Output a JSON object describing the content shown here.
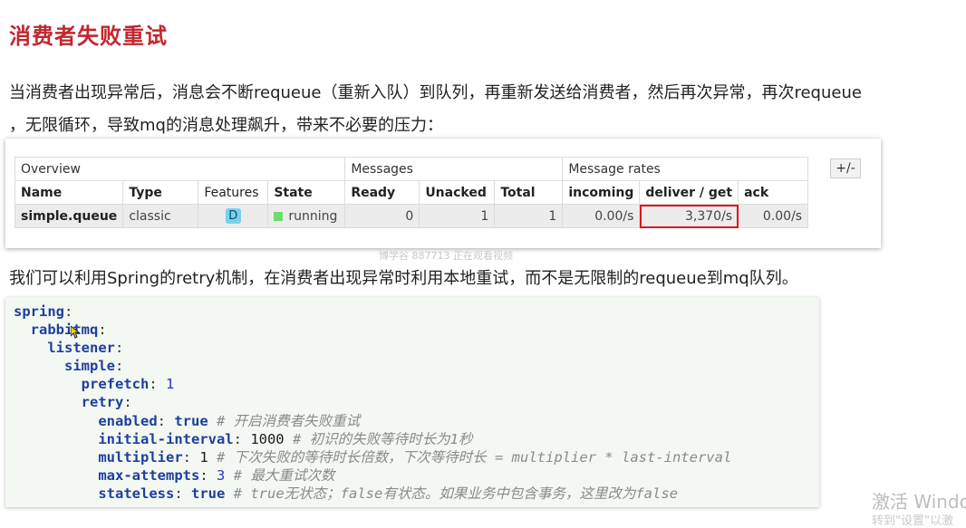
{
  "title": "消费者失败重试",
  "paragraph1": "当消费者出现异常后，消息会不断requeue（重新入队）到队列，再重新发送给消费者，然后再次异常，再次requeue",
  "paragraph2": "，无限循环，导致mq的消息处理飙升，带来不必要的压力：",
  "paragraph3": "我们可以利用Spring的retry机制，在消费者出现异常时利用本地重试，而不是无限制的requeue到mq队列。",
  "watermark": "博学谷 887713 正在观看视频",
  "queue_table": {
    "groups": {
      "overview": "Overview",
      "messages": "Messages",
      "message_rates": "Message rates"
    },
    "toggle": "+/-",
    "columns": {
      "name": "Name",
      "type": "Type",
      "features": "Features",
      "state": "State",
      "ready": "Ready",
      "unacked": "Unacked",
      "total": "Total",
      "incoming": "incoming",
      "deliver_get": "deliver / get",
      "ack": "ack"
    },
    "row": {
      "name": "simple.queue",
      "type": "classic",
      "features": "D",
      "state": "running",
      "ready": "0",
      "unacked": "1",
      "total": "1",
      "incoming": "0.00/s",
      "deliver_get": "3,370/s",
      "ack": "0.00/s"
    },
    "state_color": "#6fdc6f",
    "highlight_color": "#e0141e"
  },
  "code": {
    "spring": "spring",
    "rabbitmq": "rabbitmq",
    "listener": "listener",
    "simple": "simple",
    "prefetch_key": "prefetch",
    "prefetch_val": "1",
    "retry": "retry",
    "enabled_key": "enabled",
    "enabled_val": "true",
    "enabled_comment": "# 开启消费者失败重试",
    "initial_key": "initial-interval",
    "initial_val": "1000",
    "initial_comment": "# 初识的失败等待时长为1秒",
    "mult_key": "multiplier",
    "mult_val": "1",
    "mult_comment": "# 下次失败的等待时长倍数，下次等待时长 = multiplier * last-interval",
    "max_key": "max-attempts",
    "max_val": "3",
    "max_comment": "# 最大重试次数",
    "stateless_key": "stateless",
    "stateless_val": "true",
    "stateless_comment": "# true无状态；false有状态。如果业务中包含事务，这里改为false"
  },
  "windows_activation": "激活 Windo",
  "windows_activation_sub": "转到\"设置\"以激"
}
